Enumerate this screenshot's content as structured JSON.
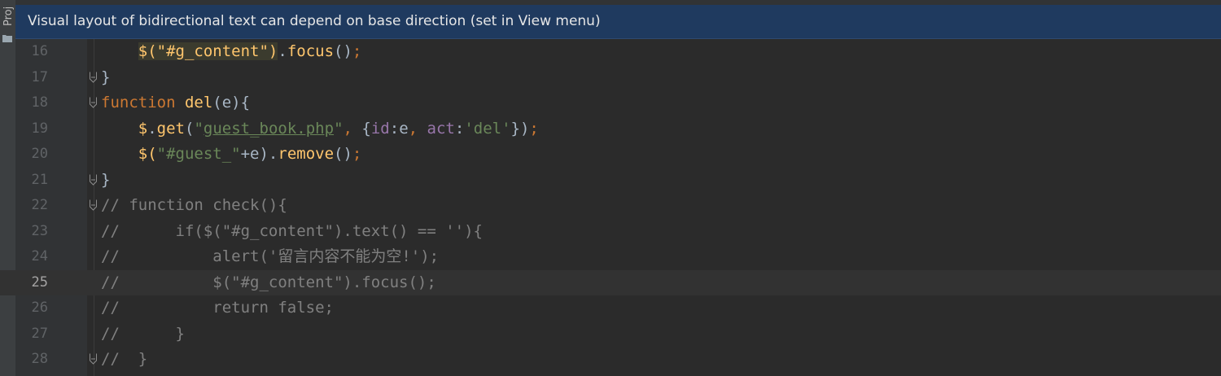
{
  "banner": {
    "message": "Visual layout of bidirectional text can depend on base direction (set in View menu)"
  },
  "sidebar": {
    "tool_window_label": "Proj"
  },
  "editor": {
    "current_line": "25",
    "lines": [
      {
        "number": "16",
        "t": [
          "    ",
          "$(\"#g_content\")",
          ".",
          "focus",
          "()",
          ";"
        ]
      },
      {
        "number": "17",
        "t": [
          "}"
        ]
      },
      {
        "number": "18",
        "t": [
          "function",
          " ",
          "del",
          "(e){"
        ]
      },
      {
        "number": "19",
        "t": [
          "    ",
          "$",
          ".",
          "get",
          "(",
          "\"",
          "guest_book.php",
          "\"",
          ", ",
          "{",
          "id",
          ":e",
          ", ",
          "act",
          ":",
          "'del'",
          "})",
          ";"
        ]
      },
      {
        "number": "20",
        "t": [
          "    ",
          "$(",
          "\"#guest_\"",
          "+e).",
          "remove",
          "()",
          ";"
        ]
      },
      {
        "number": "21",
        "t": [
          "}"
        ]
      },
      {
        "number": "22",
        "t": [
          "// function check(){"
        ]
      },
      {
        "number": "23",
        "t": [
          "//      if($(\"#g_content\").text() == ''){"
        ]
      },
      {
        "number": "24",
        "t": [
          "//          alert('留言内容不能为空!');"
        ]
      },
      {
        "number": "25",
        "t": [
          "//          $(\"#g_content\").focus();"
        ]
      },
      {
        "number": "26",
        "t": [
          "//          return false;"
        ]
      },
      {
        "number": "27",
        "t": [
          "//      }"
        ]
      },
      {
        "number": "28",
        "t": [
          "//  }"
        ]
      }
    ]
  }
}
